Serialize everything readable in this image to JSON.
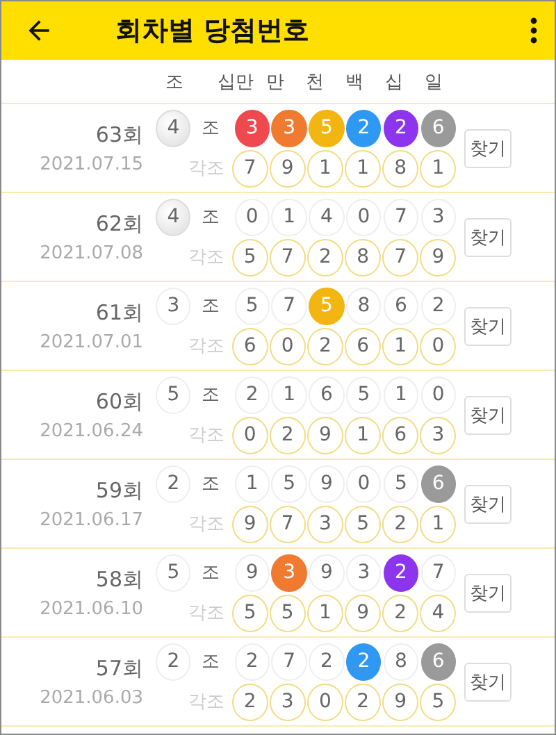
{
  "app_bar": {
    "title": "회차별 당첨번호"
  },
  "columns": [
    "조",
    "십만",
    "만",
    "천",
    "백",
    "십",
    "일"
  ],
  "rounds": [
    {
      "round": "63회",
      "date": "2021.07.15",
      "group": {
        "n": "4",
        "selected": true
      },
      "group_label": "조",
      "balls": [
        {
          "n": "3",
          "selected": true,
          "color": "#f0484f"
        },
        {
          "n": "3",
          "selected": true,
          "color": "#f07a30"
        },
        {
          "n": "5",
          "selected": true,
          "color": "#f3b511"
        },
        {
          "n": "2",
          "selected": true,
          "color": "#2f98f3"
        },
        {
          "n": "2",
          "selected": true,
          "color": "#8d35ee"
        },
        {
          "n": "6",
          "selected": true,
          "color": "#9a9a9a"
        }
      ],
      "each_label": "각조",
      "each": [
        "7",
        "9",
        "1",
        "1",
        "8",
        "1"
      ],
      "button": "찾기"
    },
    {
      "round": "62회",
      "date": "2021.07.08",
      "group": {
        "n": "4",
        "selected": true
      },
      "group_label": "조",
      "balls": [
        {
          "n": "0",
          "selected": false
        },
        {
          "n": "1",
          "selected": false
        },
        {
          "n": "4",
          "selected": false
        },
        {
          "n": "0",
          "selected": false
        },
        {
          "n": "7",
          "selected": false
        },
        {
          "n": "3",
          "selected": false
        }
      ],
      "each_label": "각조",
      "each": [
        "5",
        "7",
        "2",
        "8",
        "7",
        "9"
      ],
      "button": "찾기"
    },
    {
      "round": "61회",
      "date": "2021.07.01",
      "group": {
        "n": "3",
        "selected": false
      },
      "group_label": "조",
      "balls": [
        {
          "n": "5",
          "selected": false
        },
        {
          "n": "7",
          "selected": false
        },
        {
          "n": "5",
          "selected": true,
          "color": "#f3b511"
        },
        {
          "n": "8",
          "selected": false
        },
        {
          "n": "6",
          "selected": false
        },
        {
          "n": "2",
          "selected": false
        }
      ],
      "each_label": "각조",
      "each": [
        "6",
        "0",
        "2",
        "6",
        "1",
        "0"
      ],
      "button": "찾기"
    },
    {
      "round": "60회",
      "date": "2021.06.24",
      "group": {
        "n": "5",
        "selected": false
      },
      "group_label": "조",
      "balls": [
        {
          "n": "2",
          "selected": false
        },
        {
          "n": "1",
          "selected": false
        },
        {
          "n": "6",
          "selected": false
        },
        {
          "n": "5",
          "selected": false
        },
        {
          "n": "1",
          "selected": false
        },
        {
          "n": "0",
          "selected": false
        }
      ],
      "each_label": "각조",
      "each": [
        "0",
        "2",
        "9",
        "1",
        "6",
        "3"
      ],
      "button": "찾기"
    },
    {
      "round": "59회",
      "date": "2021.06.17",
      "group": {
        "n": "2",
        "selected": false
      },
      "group_label": "조",
      "balls": [
        {
          "n": "1",
          "selected": false
        },
        {
          "n": "5",
          "selected": false
        },
        {
          "n": "9",
          "selected": false
        },
        {
          "n": "0",
          "selected": false
        },
        {
          "n": "5",
          "selected": false
        },
        {
          "n": "6",
          "selected": true,
          "color": "#9a9a9a"
        }
      ],
      "each_label": "각조",
      "each": [
        "9",
        "7",
        "3",
        "5",
        "2",
        "1"
      ],
      "button": "찾기"
    },
    {
      "round": "58회",
      "date": "2021.06.10",
      "group": {
        "n": "5",
        "selected": false
      },
      "group_label": "조",
      "balls": [
        {
          "n": "9",
          "selected": false
        },
        {
          "n": "3",
          "selected": true,
          "color": "#f07a30"
        },
        {
          "n": "9",
          "selected": false
        },
        {
          "n": "3",
          "selected": false
        },
        {
          "n": "2",
          "selected": true,
          "color": "#8d35ee"
        },
        {
          "n": "7",
          "selected": false
        }
      ],
      "each_label": "각조",
      "each": [
        "5",
        "5",
        "1",
        "9",
        "2",
        "4"
      ],
      "button": "찾기"
    },
    {
      "round": "57회",
      "date": "2021.06.03",
      "group": {
        "n": "2",
        "selected": false
      },
      "group_label": "조",
      "balls": [
        {
          "n": "2",
          "selected": false
        },
        {
          "n": "7",
          "selected": false
        },
        {
          "n": "2",
          "selected": false
        },
        {
          "n": "2",
          "selected": true,
          "color": "#2f98f3"
        },
        {
          "n": "8",
          "selected": false
        },
        {
          "n": "6",
          "selected": true,
          "color": "#9a9a9a"
        }
      ],
      "each_label": "각조",
      "each": [
        "2",
        "3",
        "0",
        "2",
        "9",
        "5"
      ],
      "button": "찾기"
    }
  ]
}
